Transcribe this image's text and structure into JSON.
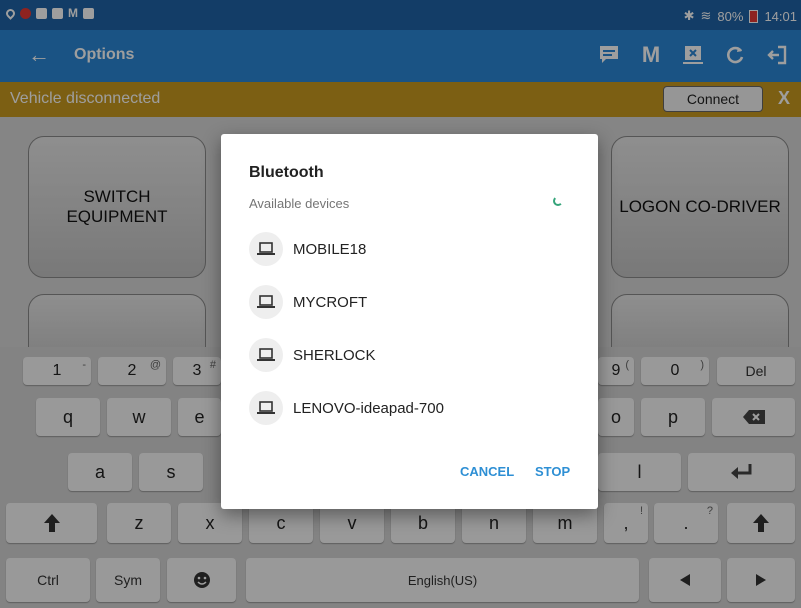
{
  "status_bar": {
    "mail_letter": "M",
    "battery": "80%",
    "time": "14:01"
  },
  "app_bar": {
    "back_icon": "arrow-left-icon",
    "title": "Options",
    "action_icons": [
      "message-icon",
      "m-letter-icon",
      "export-icon",
      "refresh-icon",
      "logout-icon"
    ],
    "m_label": "M"
  },
  "banner": {
    "text": "Vehicle disconnected",
    "connect_label": "Connect",
    "close_label": "X"
  },
  "tiles": {
    "switch_equipment": "SWITCH\nEQUIPMENT",
    "logon_codriver": "LOGON CO-DRIVER"
  },
  "dialog": {
    "title": "Bluetooth",
    "subtitle": "Available devices",
    "devices": [
      "MOBILE18",
      "MYCROFT",
      "SHERLOCK",
      "LENOVO-ideapad-700"
    ],
    "cancel_label": "CANCEL",
    "stop_label": "STOP"
  },
  "keyboard": {
    "number_row": [
      {
        "key": "1",
        "sup": "-"
      },
      {
        "key": "2",
        "sup": "@"
      },
      {
        "key": "3",
        "sup": "#"
      },
      {
        "key": "9",
        "sup": "("
      },
      {
        "key": "0",
        "sup": ")"
      },
      {
        "key": "Del",
        "sup": ""
      }
    ],
    "row1": [
      "q",
      "w",
      "e",
      "o",
      "p"
    ],
    "row2": [
      "a",
      "s",
      "l"
    ],
    "row3": [
      "z",
      "x",
      "c",
      "v",
      "b",
      "n",
      "m"
    ],
    "row3_punct": [
      ",",
      "!",
      ".",
      "?"
    ],
    "bottom": {
      "ctrl": "Ctrl",
      "sym": "Sym",
      "space": "English(US)"
    }
  },
  "colors": {
    "status_bar": "#1f63a6",
    "app_bar": "#2a86d6",
    "banner": "#c89a20",
    "accent": "#2e8fd4",
    "spinner": "#35a47a"
  }
}
